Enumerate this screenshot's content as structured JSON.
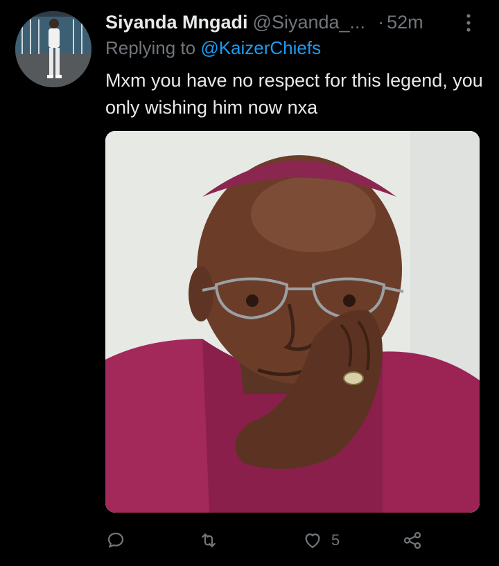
{
  "tweet": {
    "author_name": "Siyanda Mngadi",
    "author_handle": "@Siyanda_...",
    "separator": "·",
    "time": "52m",
    "replying_prefix": "Replying to",
    "replying_to": "@KaizerChiefs",
    "text": "Mxm you have no respect for this legend, you only wishing him now nxa",
    "media_icon": "photo-of-elderly-man-in-glasses-and-purple-robe"
  },
  "actions": {
    "reply_icon": "reply-icon",
    "retweet_icon": "retweet-icon",
    "like_icon": "heart-icon",
    "like_count": "5",
    "share_icon": "share-icon"
  },
  "colors": {
    "background": "#000000",
    "primary_text": "#e7e9ea",
    "secondary_text": "#71767b",
    "accent": "#1d9bf0"
  }
}
